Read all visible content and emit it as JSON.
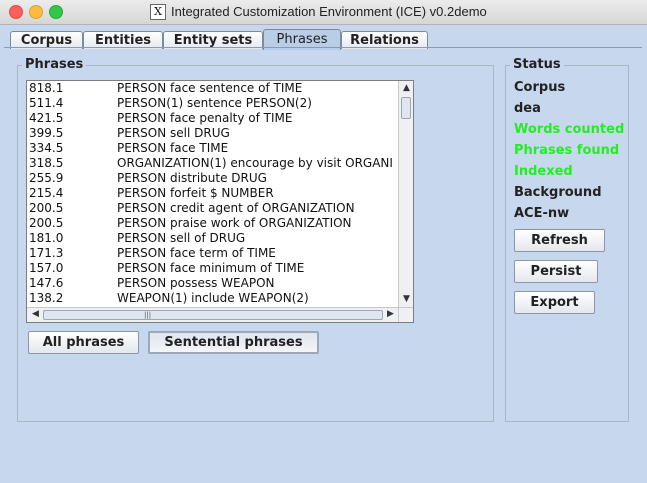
{
  "window": {
    "title": "Integrated Customization Environment (ICE) v0.2demo",
    "icon_glyph": "X"
  },
  "tabs": [
    {
      "label": "Corpus",
      "active": false
    },
    {
      "label": "Entities",
      "active": false
    },
    {
      "label": "Entity sets",
      "active": false
    },
    {
      "label": "Phrases",
      "active": true
    },
    {
      "label": "Relations",
      "active": false
    }
  ],
  "phrases": {
    "title": "Phrases",
    "rows": [
      {
        "score": "818.1",
        "text": "PERSON face sentence of TIME"
      },
      {
        "score": "511.4",
        "text": "PERSON(1) sentence PERSON(2)"
      },
      {
        "score": "421.5",
        "text": "PERSON face penalty of TIME"
      },
      {
        "score": "399.5",
        "text": "PERSON sell DRUG"
      },
      {
        "score": "334.5",
        "text": "PERSON face TIME"
      },
      {
        "score": "318.5",
        "text": "ORGANIZATION(1) encourage by visit ORGANI"
      },
      {
        "score": "255.9",
        "text": "PERSON distribute DRUG"
      },
      {
        "score": "215.4",
        "text": "PERSON forfeit $ NUMBER"
      },
      {
        "score": "200.5",
        "text": "PERSON credit agent of ORGANIZATION"
      },
      {
        "score": "200.5",
        "text": "PERSON praise work of ORGANIZATION"
      },
      {
        "score": "181.0",
        "text": "PERSON sell of DRUG"
      },
      {
        "score": "171.3",
        "text": "PERSON face term of TIME"
      },
      {
        "score": "157.0",
        "text": "PERSON face minimum of TIME"
      },
      {
        "score": "147.6",
        "text": "PERSON possess WEAPON"
      },
      {
        "score": "138.2",
        "text": "WEAPON(1) include WEAPON(2)"
      }
    ],
    "buttons": {
      "all": "All phrases",
      "sentential": "Sentential phrases"
    }
  },
  "status": {
    "title": "Status",
    "items": [
      {
        "label": "Corpus",
        "color": "#222222"
      },
      {
        "label": "dea",
        "color": "#222222"
      },
      {
        "label": "Words counted",
        "color": "#22ee22"
      },
      {
        "label": "Phrases found",
        "color": "#22ee22"
      },
      {
        "label": "Indexed",
        "color": "#22ee22"
      },
      {
        "label": "Background",
        "color": "#222222"
      },
      {
        "label": "ACE-nw",
        "color": "#222222"
      }
    ],
    "buttons": {
      "refresh": "Refresh",
      "persist": "Persist",
      "export": "Export"
    }
  },
  "icons": {
    "scroll_up": "▲",
    "scroll_down": "▼",
    "scroll_left": "◀",
    "scroll_right": "▶",
    "grip": "|||"
  }
}
